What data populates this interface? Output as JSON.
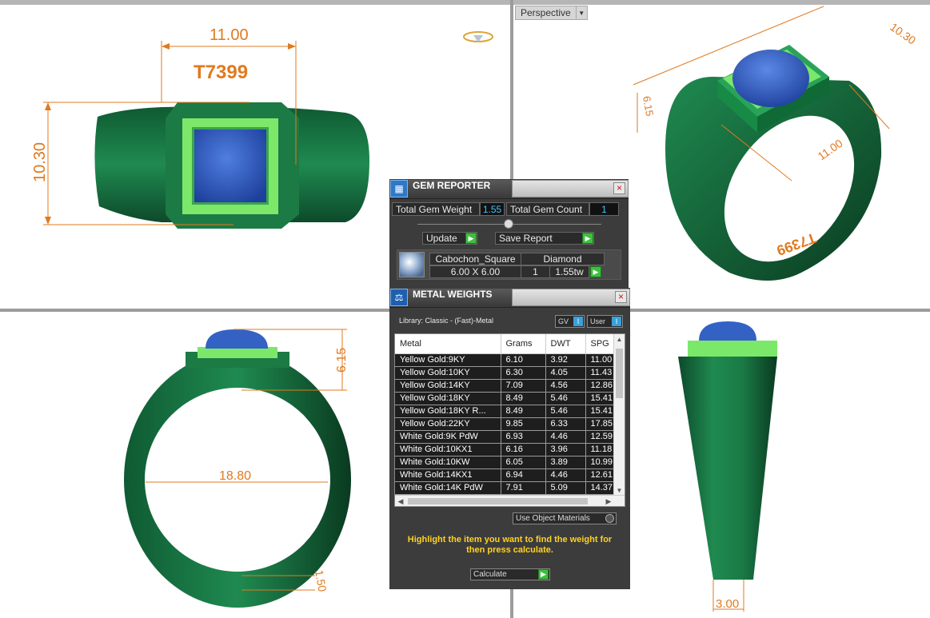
{
  "viewport_perspective": {
    "label": "Perspective"
  },
  "dimensions": {
    "top_width": "11.00",
    "top_height": "10.30",
    "model_code": "T7399",
    "persp_length": "10.30",
    "persp_height": "6.15",
    "persp_width": "11.00",
    "persp_code": "T7399",
    "side_height": "6.15",
    "inner_diameter": "18.80",
    "shank_thickness": "1.50",
    "end_width": "3.00"
  },
  "gem_reporter": {
    "title": "GEM REPORTER",
    "close": "×",
    "total_gem_weight_label": "Total Gem Weight",
    "total_gem_weight": "1.55",
    "total_gem_count_label": "Total Gem Count",
    "total_gem_count": "1",
    "update_label": "Update",
    "save_report_label": "Save Report",
    "gem": {
      "shape": "Cabochon_Square",
      "type": "Diamond",
      "size": "6.00 X 6.00",
      "count": "1",
      "weight": "1.55tw"
    }
  },
  "metal_weights": {
    "title": "METAL WEIGHTS",
    "close": "×",
    "library": "Library: Classic - (Fast)-Metal",
    "gv_label": "GV",
    "user_label": "User",
    "toggle_glyph": "I",
    "columns": [
      "Metal",
      "Grams",
      "DWT",
      "SPG"
    ],
    "rows": [
      [
        "Yellow Gold:9KY",
        "6.10",
        "3.92",
        "11.00"
      ],
      [
        "Yellow Gold:10KY",
        "6.30",
        "4.05",
        "11.43"
      ],
      [
        "Yellow Gold:14KY",
        "7.09",
        "4.56",
        "12.86"
      ],
      [
        "Yellow Gold:18KY",
        "8.49",
        "5.46",
        "15.41"
      ],
      [
        "Yellow Gold:18KY R...",
        "8.49",
        "5.46",
        "15.41"
      ],
      [
        "Yellow Gold:22KY",
        "9.85",
        "6.33",
        "17.85"
      ],
      [
        "White Gold:9K PdW",
        "6.93",
        "4.46",
        "12.59"
      ],
      [
        "White Gold:10KX1",
        "6.16",
        "3.96",
        "11.18"
      ],
      [
        "White Gold:10KW",
        "6.05",
        "3.89",
        "10.99"
      ],
      [
        "White Gold:14KX1",
        "6.94",
        "4.46",
        "12.61"
      ],
      [
        "White Gold:14K PdW",
        "7.91",
        "5.09",
        "14.37"
      ]
    ],
    "use_object_materials": "Use Object Materials",
    "hint": "Highlight the item you want to find the weight for then press calculate.",
    "calculate_label": "Calculate"
  },
  "colors": {
    "metal_green": "#1e7a48",
    "bezel_green": "#7be86a",
    "stone_blue": "#3362c4",
    "dimension_orange": "#e07a1f",
    "hint_yellow": "#ffd21f",
    "value_cyan": "#40c4ff"
  }
}
